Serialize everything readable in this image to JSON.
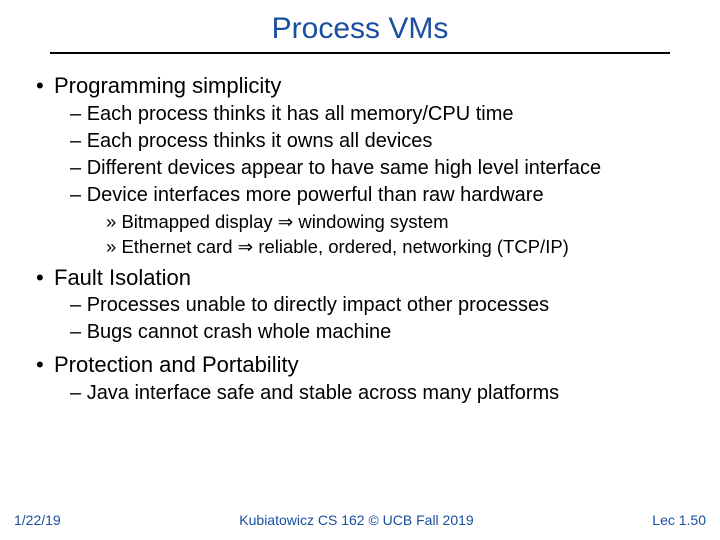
{
  "title": "Process VMs",
  "bullets": {
    "b1": "Programming simplicity",
    "b1_1": "Each process thinks it has all memory/CPU time",
    "b1_2": "Each process thinks it owns all devices",
    "b1_3": "Different devices appear to have same high level interface",
    "b1_4": "Device interfaces more powerful than raw hardware",
    "b1_4_1a": "Bitmapped display",
    "b1_4_1b": "windowing system",
    "b1_4_2a": "Ethernet card",
    "b1_4_2b": "reliable, ordered, networking (TCP/IP)",
    "b2": "Fault Isolation",
    "b2_1": "Processes unable to directly impact other processes",
    "b2_2": "Bugs cannot crash whole machine",
    "b3": "Protection and Portability",
    "b3_1": "Java interface safe and stable across many platforms"
  },
  "footer": {
    "date": "1/22/19",
    "center": "Kubiatowicz CS 162 © UCB Fall 2019",
    "right": "Lec 1.50"
  },
  "glyphs": {
    "implies": "⇒"
  }
}
